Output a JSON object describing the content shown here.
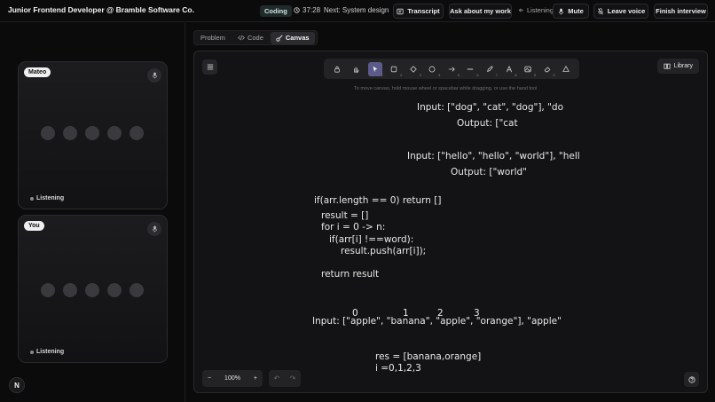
{
  "header": {
    "title": "Junior Frontend Developer @ Bramble Software Co.",
    "mode_badge": "Coding",
    "timer": "37:28",
    "next_label": "Next: System design",
    "transcript_label": "Transcript",
    "ask_label": "Ask about my work",
    "listening_label": "Listening",
    "mute_label": "Mute",
    "leave_voice_label": "Leave voice",
    "finish_label": "Finish interview"
  },
  "participants": [
    {
      "name": "Mateo",
      "status": "Listening"
    },
    {
      "name": "You",
      "status": "Listening"
    }
  ],
  "logo_letter": "N",
  "tabs": [
    {
      "label": "Problem",
      "active": false
    },
    {
      "label": "Code",
      "active": false
    },
    {
      "label": "Canvas",
      "active": true
    }
  ],
  "canvas": {
    "library_label": "Library",
    "hint": "To move canvas, hold mouse wheel or spacebar while dragging, or use the hand tool",
    "zoom": "100%",
    "toolbar_shortcuts": [
      "",
      "",
      "1",
      "2",
      "3",
      "4",
      "5",
      "6",
      "7",
      "8",
      "9",
      "0",
      ""
    ],
    "handwriting": {
      "line1": "Input: [\"dog\", \"cat\", \"dog\"], \"do",
      "line2": "Output: [\"cat",
      "line3": "Input: [\"hello\", \"hello\", \"world\"], \"hell",
      "line4": "Output: [\"world\"",
      "code1": "if(arr.length == 0) return []",
      "code2": "result = []",
      "code3": "for i = 0 -> n:",
      "code4": "if(arr[i] !==word):",
      "code5": "result.push(arr[i]);",
      "code6": "return result",
      "idx0": "0",
      "idx1": "1",
      "idx2": "2",
      "idx3": "3",
      "input3": "Input: [\"apple\", \"banana\", \"apple\", \"orange\"], \"apple\"",
      "res": "res = [banana,orange]",
      "iline": "i =0,1,2,3"
    }
  },
  "colors": {
    "background": "#0b0b0c",
    "canvas": "#131315",
    "selected_tool": "#5b5a8a"
  }
}
